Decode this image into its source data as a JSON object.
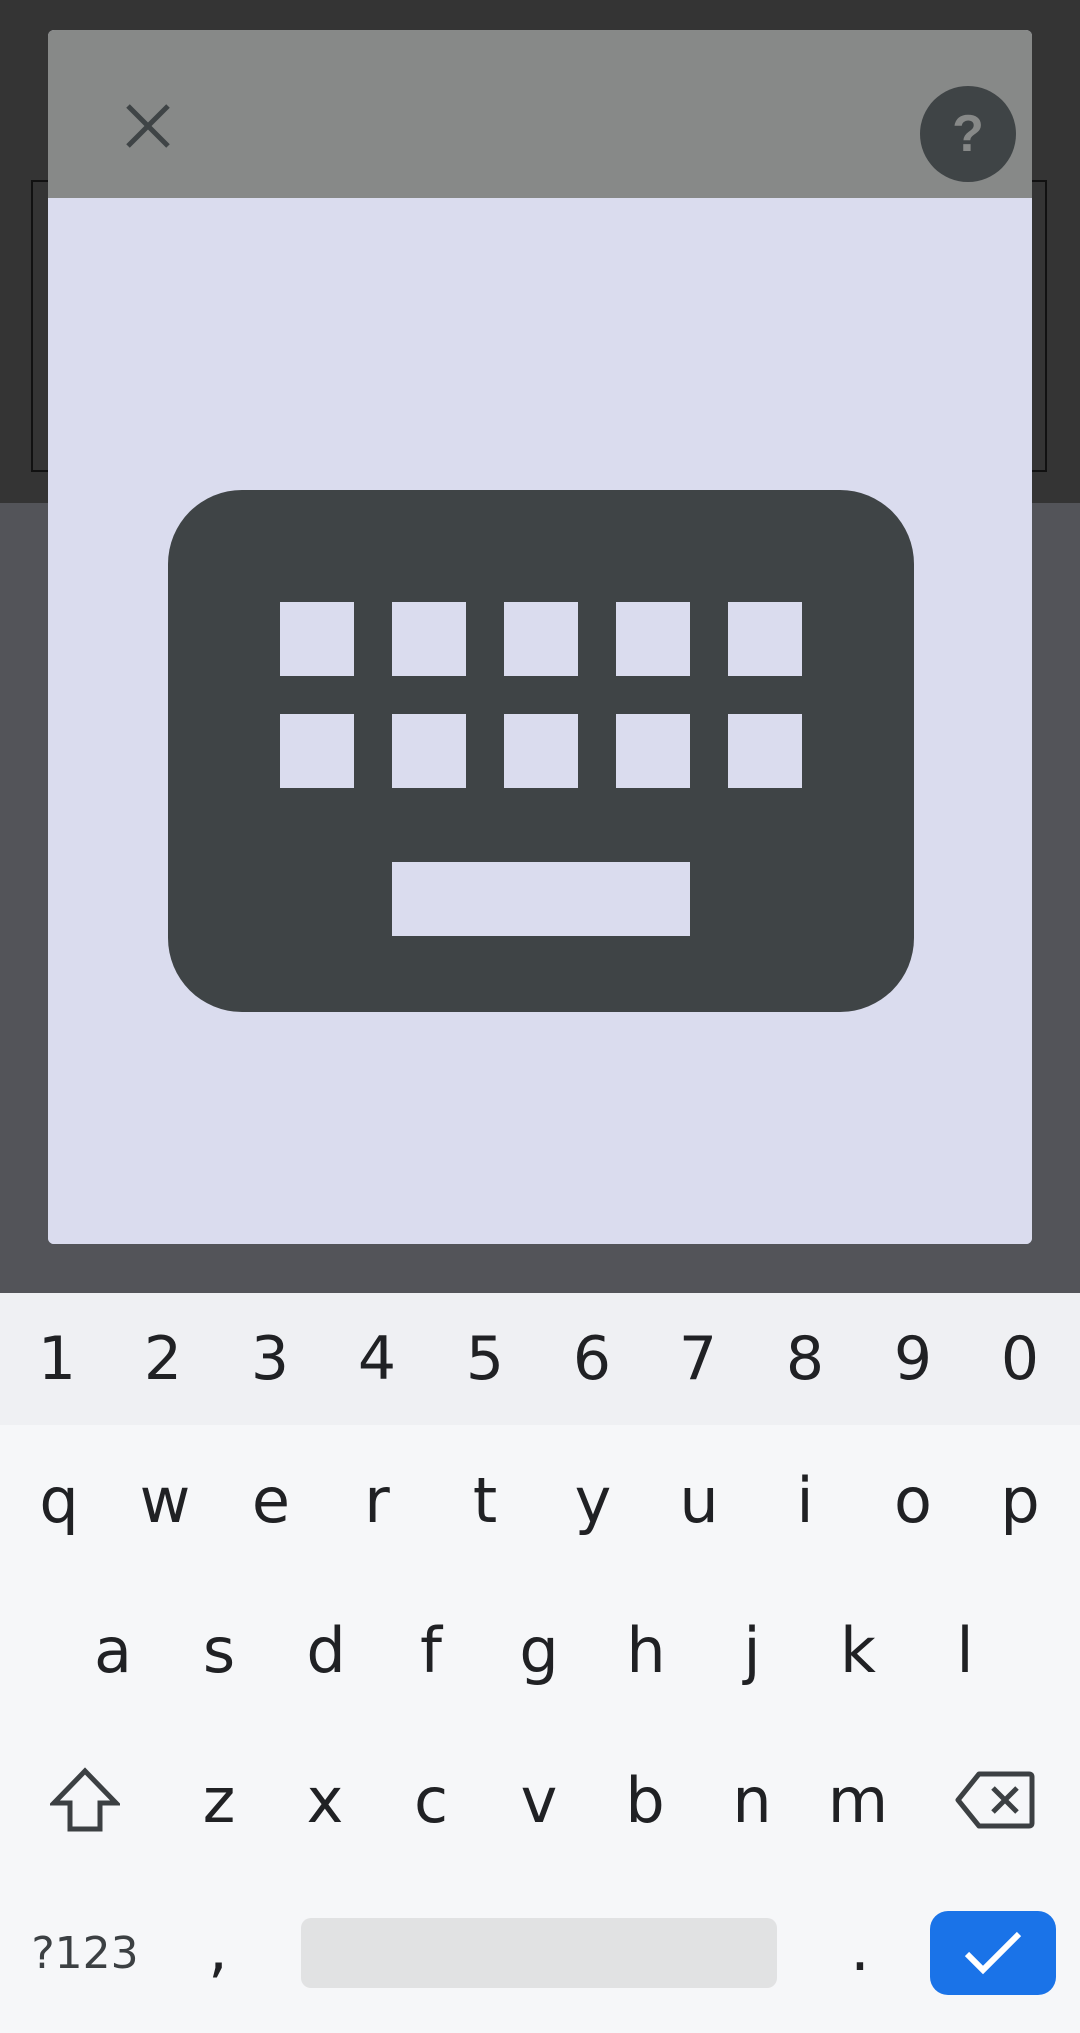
{
  "dialog": {
    "close_icon": "close-icon",
    "help_icon": "help-icon",
    "illustration_icon": "keyboard-icon",
    "colors": {
      "header": "#878988",
      "body": "#DADCEE",
      "illustration": "#3F4446"
    }
  },
  "keyboard": {
    "number_row": [
      "1",
      "2",
      "3",
      "4",
      "5",
      "6",
      "7",
      "8",
      "9",
      "0"
    ],
    "row1": [
      "q",
      "w",
      "e",
      "r",
      "t",
      "y",
      "u",
      "i",
      "o",
      "p"
    ],
    "row2": [
      "a",
      "s",
      "d",
      "f",
      "g",
      "h",
      "j",
      "k",
      "l"
    ],
    "row3": [
      "z",
      "x",
      "c",
      "v",
      "b",
      "n",
      "m"
    ],
    "symbols_label": "?123",
    "comma_label": ",",
    "period_label": ".",
    "shift_icon": "shift-icon",
    "backspace_icon": "backspace-icon",
    "enter_icon": "checkmark-icon",
    "accent_color": "#1A73E8"
  }
}
